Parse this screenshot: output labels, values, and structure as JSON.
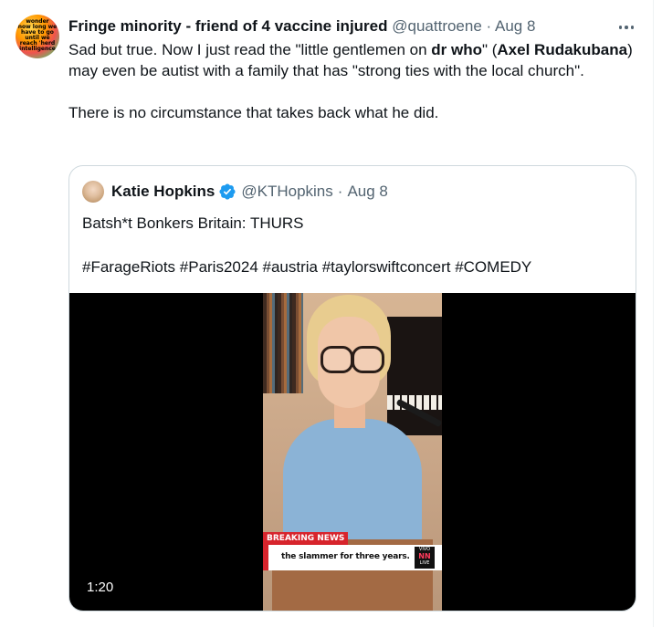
{
  "tweet": {
    "avatar_text": [
      "wonder",
      "now long we",
      "have to go",
      "until we",
      "reach 'herd",
      "intelligence"
    ],
    "author_name": "Fringe minority - friend of 4 vaccine injured",
    "handle": "@quattroene",
    "separator": "·",
    "date": "Aug 8",
    "more_icon": "more-horizontal-icon",
    "text_parts": [
      {
        "text": "Sad but true. Now I just read the \"little gentlemen on ",
        "bold": false
      },
      {
        "text": "dr who",
        "bold": true
      },
      {
        "text": "\" (",
        "bold": false
      },
      {
        "text": "Axel Rudakubana",
        "bold": true
      },
      {
        "text": ") may even be autist with a family that has \"strong ties with the local church\".",
        "bold": false
      }
    ],
    "paragraph2": "There is no circumstance that takes back what he did."
  },
  "quote": {
    "author_name": "Katie Hopkins",
    "verified_icon": "verified-badge-icon",
    "verified_color": "#1d9bf0",
    "handle": "@KTHopkins",
    "separator": "·",
    "date": "Aug 8",
    "line1": "Batsh*t Bonkers Britain: THURS",
    "hashtags": "#FarageRiots #Paris2024 #austria #taylorswiftconcert #COMEDY",
    "video": {
      "breaking_label": "BREAKING NEWS",
      "ticker_text": "the slammer for three years.",
      "logo_top": "VIVO",
      "logo_mid": "NN",
      "logo_bottom": "LIVE",
      "duration": "1:20"
    }
  }
}
